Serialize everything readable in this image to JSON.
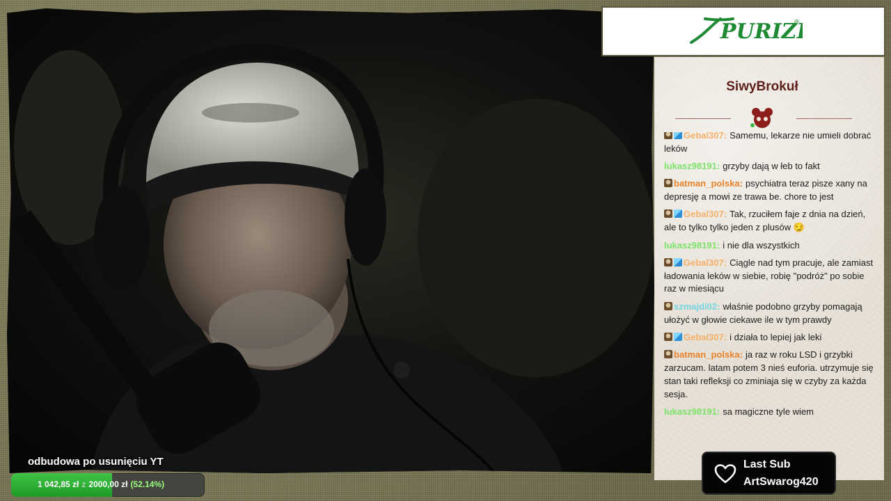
{
  "logo": {
    "text": "PURIZE",
    "mark": "®"
  },
  "chat": {
    "channel": "SiwyBrokuł",
    "messages": [
      {
        "badges": [
          "mono",
          "cube"
        ],
        "user": "Gebal307:",
        "user_color": "#f5b06a",
        "text": "Samemu, lekarze nie umieli dobrać leków"
      },
      {
        "badges": [],
        "user": "lukasz98191:",
        "user_color": "#7de36b",
        "text": "grzyby dają w łeb to fakt"
      },
      {
        "badges": [
          "mono"
        ],
        "user": "batman_polska:",
        "user_color": "#e8832d",
        "text": "psychiatra teraz pisze xany na depresję a mowi ze trawa be. chore to jest"
      },
      {
        "badges": [
          "mono",
          "cube"
        ],
        "user": "Gebal307:",
        "user_color": "#f5b06a",
        "text": "Tak, rzuciłem faje z dnia na dzień, ale to tylko tylko jeden z plusów 😏"
      },
      {
        "badges": [],
        "user": "lukasz98191:",
        "user_color": "#7de36b",
        "text": "i nie dla wszystkich"
      },
      {
        "badges": [
          "mono",
          "cube"
        ],
        "user": "Gebal307:",
        "user_color": "#f5b06a",
        "text": "Ciągle nad tym pracuje, ale zamiast ładowania leków w siebie, robię \"podróż\" po sobie raz w miesiącu"
      },
      {
        "badges": [
          "mono"
        ],
        "user": "szmajdi02:",
        "user_color": "#74d5e0",
        "text": "właśnie podobno grzyby pomagają ułożyć w głowie ciekawe ile w tym prawdy"
      },
      {
        "badges": [
          "mono",
          "cube"
        ],
        "user": "Gebal307:",
        "user_color": "#f5b06a",
        "text": "i działa to lepiej jak leki"
      },
      {
        "badges": [
          "mono"
        ],
        "user": "batman_polska:",
        "user_color": "#e8832d",
        "text": "ja raz w roku LSD i grzybki zarzucam. latam potem 3 nieś euforia. utrzymuje się stan taki refleksji co zminiaja się w czyby za każda sesja."
      },
      {
        "badges": [],
        "user": "lukasz98191:",
        "user_color": "#7de36b",
        "text": "sa magiczne tyle wiem"
      }
    ]
  },
  "last_sub": {
    "title": "Last Sub",
    "name": "ArtSwarog420"
  },
  "goal": {
    "title": "odbudowa po usunięciu YT",
    "current": "1 042,85 zł",
    "separator": "z",
    "target": "2000,00 zł",
    "percent_label": "(52.14%)",
    "progress": 0.5214
  },
  "colors": {
    "goal_fill": "#2fb437",
    "channel_name": "#5e1f1a",
    "logo_green": "#1f8a34"
  }
}
